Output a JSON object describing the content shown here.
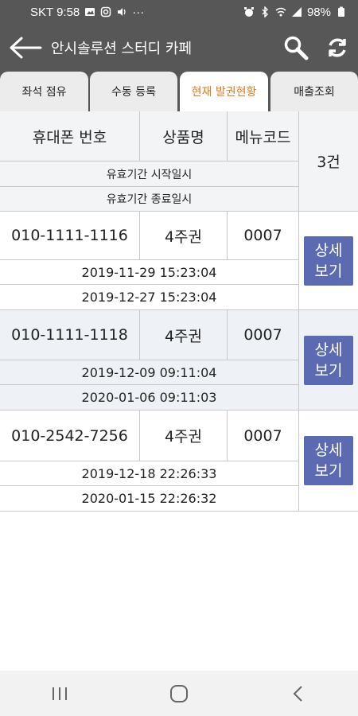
{
  "status_bar": {
    "carrier_time": "SKT 9:58",
    "dots": "···",
    "battery": "98%"
  },
  "app_bar": {
    "title": "안시솔루션 스터디 카페",
    "back_icon": "arrow-left-icon",
    "search_icon": "search-icon",
    "refresh_icon": "refresh-icon"
  },
  "tabs": [
    {
      "label": "좌석 점유",
      "active": false
    },
    {
      "label": "수동 등록",
      "active": false
    },
    {
      "label": "현재 발권현황",
      "active": true
    },
    {
      "label": "매출조회",
      "active": false
    }
  ],
  "table": {
    "headers": {
      "phone": "휴대폰 번호",
      "product": "상품명",
      "menu_code": "메뉴코드",
      "start": "유효기간 시작일시",
      "end": "유효기간 종료일시",
      "count": "3건"
    },
    "rows": [
      {
        "phone": "010-1111-1116",
        "product": "4주권",
        "menu_code": "0007",
        "start": "2019-11-29 15:23:04",
        "end": "2019-12-27 15:23:04",
        "detail_line1": "상세",
        "detail_line2": "보기"
      },
      {
        "phone": "010-1111-1118",
        "product": "4주권",
        "menu_code": "0007",
        "start": "2019-12-09 09:11:04",
        "end": "2020-01-06 09:11:03",
        "detail_line1": "상세",
        "detail_line2": "보기"
      },
      {
        "phone": "010-2542-7256",
        "product": "4주권",
        "menu_code": "0007",
        "start": "2019-12-18 22:26:33",
        "end": "2020-01-15 22:26:32",
        "detail_line1": "상세",
        "detail_line2": "보기"
      }
    ]
  },
  "colors": {
    "bar": "#575757",
    "active_tab_text": "#e07a1c",
    "detail_button": "#5c6bb1"
  }
}
